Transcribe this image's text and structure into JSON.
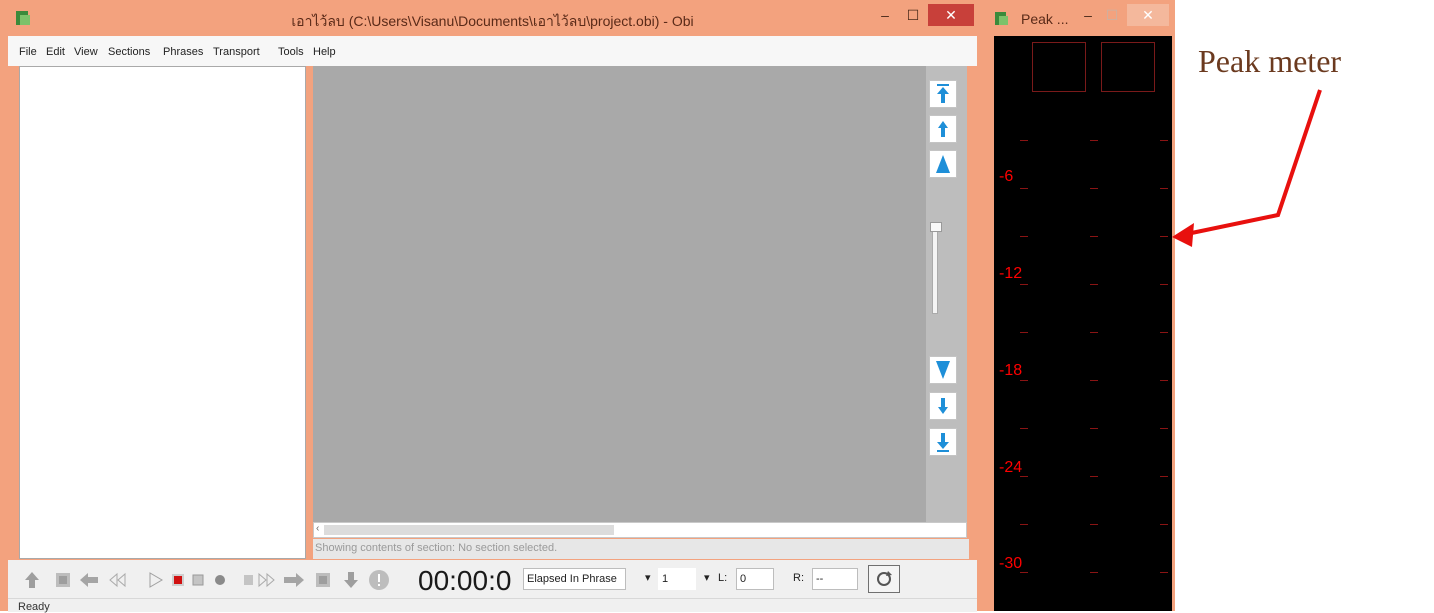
{
  "main_window": {
    "title": "เอาไว้ลบ (C:\\Users\\Visanu\\Documents\\เอาไว้ลบ\\project.obi) - Obi",
    "menu": [
      "File",
      "Edit",
      "View",
      "Sections",
      "Phrases",
      "Transport",
      "Tools",
      "Help"
    ],
    "status_text": "Showing contents of section:  No section selected.",
    "time_display": "00:00:0",
    "time_mode": "Elapsed In Phrase",
    "level_value": "1",
    "l_label": "L:",
    "l_value": "0",
    "r_label": "R:",
    "r_value": "--",
    "ready": "Ready"
  },
  "peak_window": {
    "title": "Peak ...",
    "db_labels": [
      "-6",
      "-12",
      "-18",
      "-24",
      "-30"
    ]
  },
  "annotation": {
    "text": "Peak meter",
    "arrow_color": "#e8100e"
  },
  "colors": {
    "window_frame": "#f3a27e",
    "close_button": "#c8403a",
    "content_gray": "#a9a9a9",
    "nav_blue": "#1e8fd8",
    "meter_red": "#ff0000"
  }
}
